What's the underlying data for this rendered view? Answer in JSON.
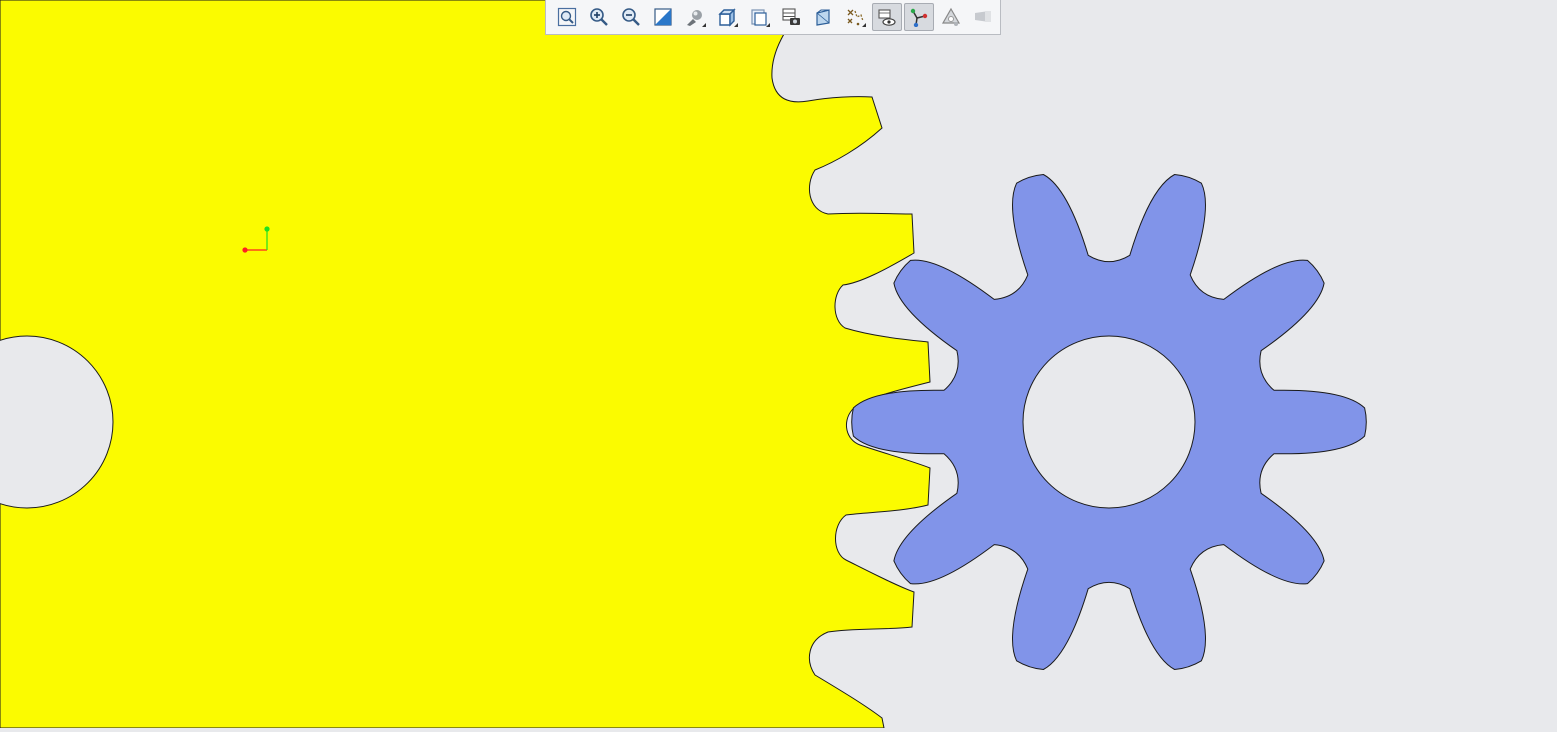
{
  "app": {
    "name": "",
    "colors": {
      "background": "#e8e9ec",
      "rack_fill": "#fbfb00",
      "gear_fill": "#8194e9",
      "outline": "#1a1a1a",
      "triad_x": "#ff2020",
      "triad_y": "#20e020"
    }
  },
  "toolbar": {
    "buttons": [
      {
        "id": "zoom-to-fit",
        "icon": "zoom-to-fit-icon",
        "active": false,
        "flyout": false
      },
      {
        "id": "zoom-in",
        "icon": "zoom-in-icon",
        "active": false,
        "flyout": false
      },
      {
        "id": "zoom-out",
        "icon": "zoom-out-icon",
        "active": false,
        "flyout": false
      },
      {
        "id": "section-view",
        "icon": "section-view-icon",
        "active": false,
        "flyout": false
      },
      {
        "id": "display-style",
        "icon": "display-style-icon",
        "active": false,
        "flyout": true
      },
      {
        "id": "view-orientation",
        "icon": "view-orientation-icon",
        "active": false,
        "flyout": true
      },
      {
        "id": "hide-show",
        "icon": "hide-show-icon",
        "active": false,
        "flyout": true
      },
      {
        "id": "view-manager",
        "icon": "view-manager-icon",
        "active": false,
        "flyout": false
      },
      {
        "id": "perspective",
        "icon": "perspective-icon",
        "active": false,
        "flyout": false
      },
      {
        "id": "datum-display",
        "icon": "datum-display-icon",
        "active": false,
        "flyout": true
      },
      {
        "id": "hidden-line",
        "icon": "hidden-line-icon",
        "active": true,
        "flyout": false
      },
      {
        "id": "triad-display",
        "icon": "triad-display-icon",
        "active": true,
        "flyout": false
      },
      {
        "id": "shadow",
        "icon": "shadow-icon",
        "active": false,
        "flyout": false
      },
      {
        "id": "annotation",
        "icon": "annotation-icon",
        "active": false,
        "flyout": false
      }
    ]
  },
  "model": {
    "rack_gear": {
      "teeth_visible": 6
    },
    "pinion_gear": {
      "teeth": 10
    }
  }
}
